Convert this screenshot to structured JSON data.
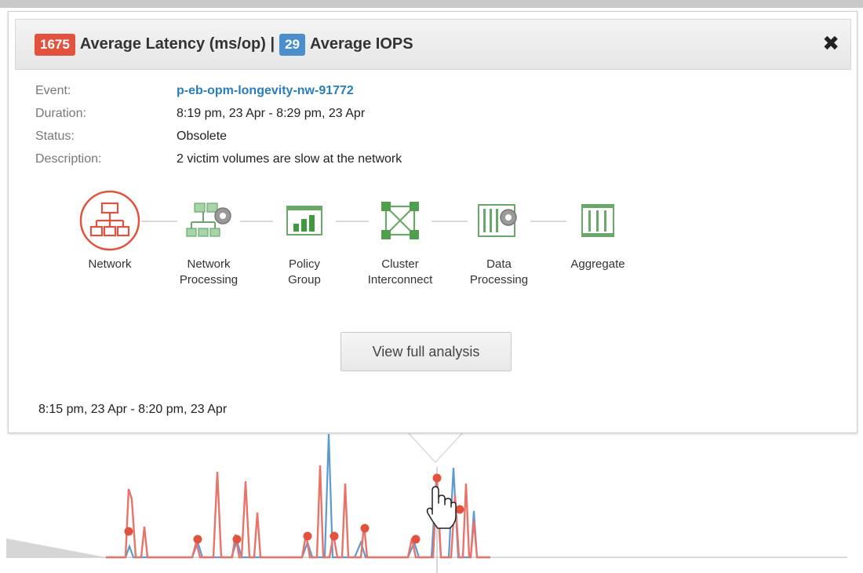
{
  "header": {
    "latency_badge": "1675",
    "latency_label": "Average Latency (ms/op) |",
    "iops_badge": "29",
    "iops_label": "Average IOPS",
    "latency_color": "#e2533f",
    "iops_color": "#4a8fcb",
    "close_icon": "close-icon"
  },
  "info": {
    "event_label": "Event:",
    "event_value": "p-eb-opm-longevity-nw-91772",
    "duration_label": "Duration:",
    "duration_value": "8:19 pm, 23 Apr - 8:29 pm, 23 Apr",
    "status_label": "Status:",
    "status_value": "Obsolete",
    "description_label": "Description:",
    "description_value": "2 victim volumes are slow at the network"
  },
  "components": [
    {
      "line1": "Network",
      "line2": "",
      "icon": "network-icon",
      "state": "contentious"
    },
    {
      "line1": "Network",
      "line2": "Processing",
      "icon": "network-processing-icon",
      "state": "normal"
    },
    {
      "line1": "Policy",
      "line2": "Group",
      "icon": "policy-group-icon",
      "state": "normal"
    },
    {
      "line1": "Cluster",
      "line2": "Interconnect",
      "icon": "cluster-interconnect-icon",
      "state": "normal"
    },
    {
      "line1": "Data",
      "line2": "Processing",
      "icon": "data-processing-icon",
      "state": "normal"
    },
    {
      "line1": "Aggregate",
      "line2": "",
      "icon": "aggregate-icon",
      "state": "normal"
    }
  ],
  "colors": {
    "contention": "#e2533f",
    "normal": "#7fbf7f",
    "latency_series": "#e8736a",
    "iops_series": "#5b9bd0"
  },
  "view_button_label": "View full analysis",
  "time_range": "8:15 pm, 23 Apr - 8:20 pm, 23 Apr"
}
